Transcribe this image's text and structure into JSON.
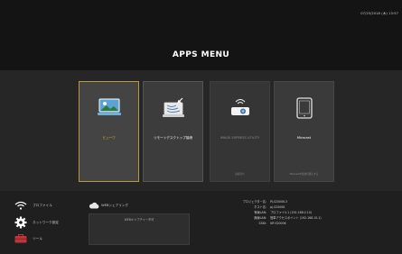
{
  "header": {
    "datetime": "07/25/2018 (木) 13:57",
    "title": "APPS MENU"
  },
  "apps": [
    {
      "label": "ビューワ",
      "sub": "",
      "icon": "viewer-icon",
      "state": "selected"
    },
    {
      "label": "リモートデスクトップ接続",
      "sub": "",
      "icon": "remote-desktop-icon",
      "state": "normal"
    },
    {
      "label": "IMAGE EXPRESS UTILITY",
      "sub": "接続待ち",
      "icon": "projector-icon",
      "state": "disabled"
    },
    {
      "label": "Miracast",
      "sub": "Miracastを使用可能にする",
      "icon": "tablet-icon",
      "state": "normal"
    }
  ],
  "bottom": {
    "profile_label": "プロファイル",
    "network_label": "ネットワーク設定",
    "tool_label": "ツール",
    "web_share_label": "WEBシェアリング",
    "web_capture_label": "WEBキャプチャー不可",
    "info": [
      {
        "key": "プロジェクター名",
        "value": "PJ-S2000K-3"
      },
      {
        "key": "ホスト名",
        "value": "pj-S2000K"
      },
      {
        "key": "有線LAN",
        "value": "プロファイル1 (192.168.0.10)"
      },
      {
        "key": "無線LAN",
        "value": "簡単アクセスポイント (192.168.10.1)"
      },
      {
        "key": "SSID",
        "value": "NP-S2000K"
      }
    ]
  },
  "colors": {
    "selected_label": "#f0c000",
    "selected_border": "#b89a3a",
    "tool_icon": "#c0353c"
  }
}
